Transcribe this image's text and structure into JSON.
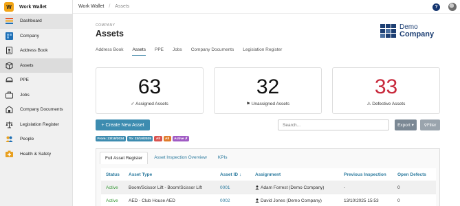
{
  "app": {
    "name": "Work Wallet",
    "logo_letter": "W"
  },
  "sidebar": {
    "items": [
      {
        "label": "Dashboard",
        "icon": "dashboard-icon",
        "color": "#e85a2a"
      },
      {
        "label": "Company",
        "icon": "company-icon",
        "color": "#1e6fb5"
      },
      {
        "label": "Address Book",
        "icon": "address-book-icon",
        "color": "#333333"
      },
      {
        "label": "Assets",
        "icon": "assets-icon",
        "color": "#333333"
      },
      {
        "label": "PPE",
        "icon": "ppe-icon",
        "color": "#333333"
      },
      {
        "label": "Jobs",
        "icon": "jobs-icon",
        "color": "#333333"
      },
      {
        "label": "Company Documents",
        "icon": "company-documents-icon",
        "color": "#333333"
      },
      {
        "label": "Legislation Register",
        "icon": "legislation-register-icon",
        "color": "#333333"
      },
      {
        "label": "People",
        "icon": "people-icon",
        "color": "#e8a020"
      },
      {
        "label": "Health & Safety",
        "icon": "health-safety-icon",
        "color": "#e8a020"
      }
    ],
    "active_index": 3
  },
  "breadcrumb": {
    "root": "Work Wallet",
    "separator": "/",
    "current": "Assets"
  },
  "header": {
    "company_label": "COMPANY",
    "title": "Assets",
    "logo_line1": "Demo",
    "logo_line2": "Company"
  },
  "tabs": [
    {
      "label": "Address Book"
    },
    {
      "label": "Assets",
      "active": true
    },
    {
      "label": "PPE"
    },
    {
      "label": "Jobs"
    },
    {
      "label": "Company Documents"
    },
    {
      "label": "Legislation Register"
    }
  ],
  "stats": [
    {
      "value": "63",
      "label": "Assigned Assets",
      "icon": "✓"
    },
    {
      "value": "32",
      "label": "Unassigned Assets",
      "icon": "⚑"
    },
    {
      "value": "33",
      "label": "Defective Assets",
      "icon": "⚠"
    }
  ],
  "toolbar": {
    "create_label": "+ Create New Asset",
    "search_placeholder": "Search...",
    "export_label": "Export ▾",
    "filter_label": "⚲Filter"
  },
  "filters": [
    {
      "label": "From: 23/10/2024",
      "color": "#3d8cb0"
    },
    {
      "label": "To: 23/10/2025",
      "color": "#3d8cb0"
    },
    {
      "label": "All",
      "color": "#d9534f"
    },
    {
      "label": "All",
      "color": "#e07b2a"
    },
    {
      "label": "Active ✗",
      "color": "#a05bc4"
    }
  ],
  "panel_tabs": [
    {
      "label": "Full Asset Register",
      "active": true
    },
    {
      "label": "Asset Inspection Overview"
    },
    {
      "label": "KPIs"
    }
  ],
  "table": {
    "headers": [
      "Status",
      "Asset Type",
      "Asset ID ↓",
      "Assignment",
      "Previous Inspection",
      "Open Defects"
    ],
    "rows": [
      [
        "Active",
        "Boom/Scissor Lift - Boom/Scissor Lift",
        "0001",
        "Adam Forrest (Demo Company)",
        "-",
        "0"
      ],
      [
        "Active",
        "AED - Club House AED",
        "0002",
        "David Jones (Demo Company)",
        "13/10/2025 15:53",
        "0"
      ]
    ]
  }
}
